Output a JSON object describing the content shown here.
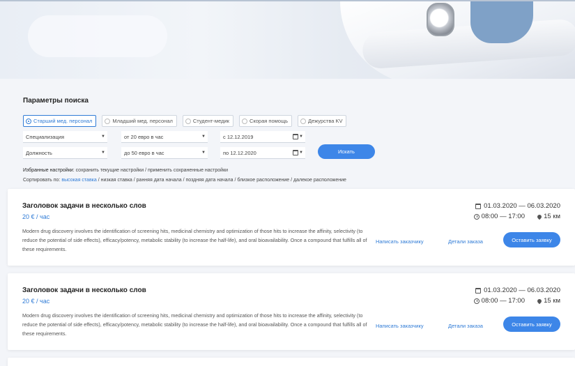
{
  "search": {
    "title": "Параметры поиска",
    "categories": [
      {
        "label": "Старший мед. персонал",
        "active": true
      },
      {
        "label": "Младший мед. персонал",
        "active": false
      },
      {
        "label": "Студент-медик",
        "active": false
      },
      {
        "label": "Скорая помощь",
        "active": false
      },
      {
        "label": "Дежурства KV",
        "active": false
      }
    ],
    "specialization": "Специализация",
    "position": "Должность",
    "rate_from": "от 20 евро в час",
    "rate_to": "до 50 евро в час",
    "date_from": "с 12.12.2019",
    "date_to": "по 12.12.2020",
    "search_button": "Искать"
  },
  "favorites": {
    "label": "Избранные настройки:",
    "save": "сохранить текущие настройки",
    "sep": " / ",
    "apply": "применить сохраненные настройки"
  },
  "sort": {
    "label": "Сортировать по:",
    "options": [
      "высокая ставка",
      "низкая ставка",
      "ранняя дата начала",
      "поздняя дата начала",
      "близкое расположение",
      "далекое расположение"
    ],
    "active_index": 0
  },
  "jobs": [
    {
      "title": "Заголовок задачи в несколько слов",
      "price": "20 € / час",
      "description": "Modern drug discovery involves the identification of screening hits, medicinal chemistry and optimization of those hits to increase the affinity, selectivity (to reduce the potential of side effects), efficacy/potency, metabolic stability (to increase the half-life), and oral bioavailability. Once a compound that fulfills all of these requirements.",
      "dates": "01.03.2020 — 06.03.2020",
      "time": "08:00 — 17:00",
      "distance": "15 км",
      "contact": "Написать заказчику",
      "details": "Детали заказа",
      "apply": "Оставить заявку"
    },
    {
      "title": "Заголовок задачи в несколько слов",
      "price": "20 € / час",
      "description": "Modern drug discovery involves the identification of screening hits, medicinal chemistry and optimization of those hits to increase the affinity, selectivity (to reduce the potential of side effects), efficacy/potency, metabolic stability (to increase the half-life), and oral bioavailability. Once a compound that fulfills all of these requirements.",
      "dates": "01.03.2020 — 06.03.2020",
      "time": "08:00 — 17:00",
      "distance": "15 км",
      "contact": "Написать заказчику",
      "details": "Детали заказа",
      "apply": "Оставить заявку"
    }
  ],
  "colors": {
    "accent": "#3d86e8",
    "link": "#2f7bd6",
    "background": "#f3f5f9"
  }
}
